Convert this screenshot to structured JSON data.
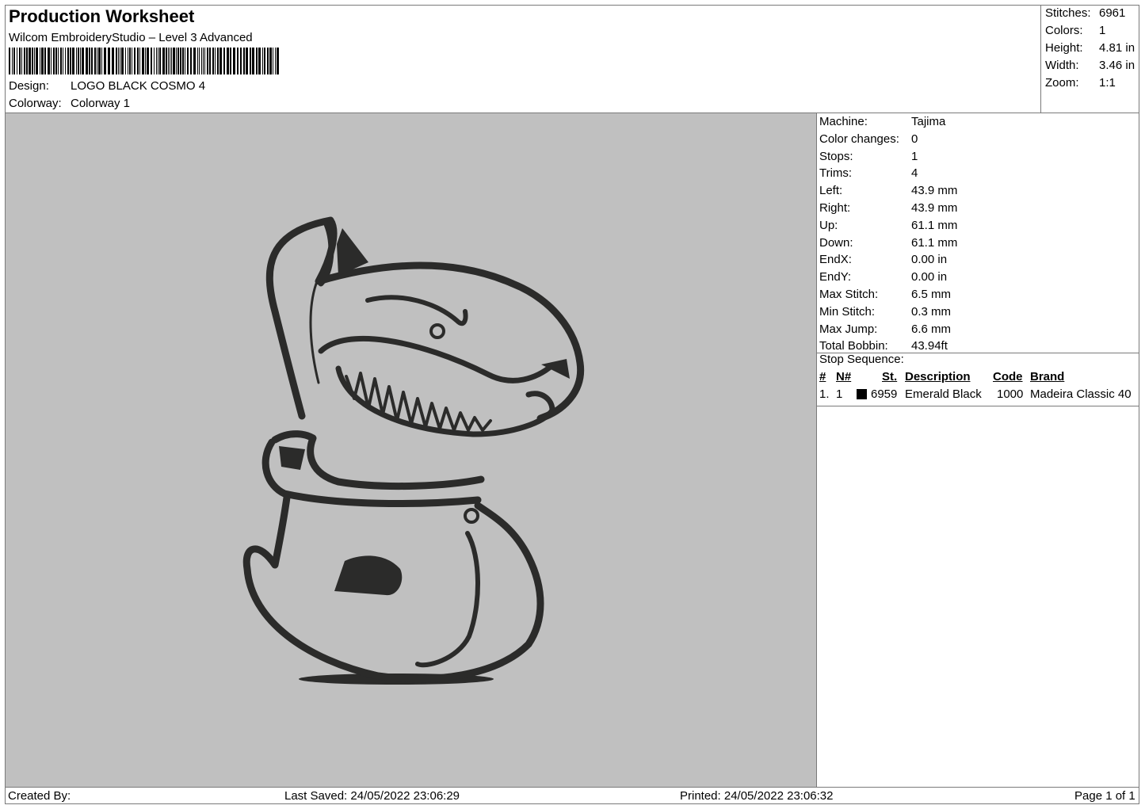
{
  "header": {
    "title": "Production Worksheet",
    "subtitle": "Wilcom EmbroideryStudio – Level 3 Advanced",
    "design_label": "Design:",
    "design_value": "LOGO BLACK COSMO 4",
    "colorway_label": "Colorway:",
    "colorway_value": "Colorway 1"
  },
  "summary": {
    "stitches_label": "Stitches:",
    "stitches_value": "6961",
    "colors_label": "Colors:",
    "colors_value": "1",
    "height_label": "Height:",
    "height_value": "4.81 in",
    "width_label": "Width:",
    "width_value": "3.46 in",
    "zoom_label": "Zoom:",
    "zoom_value": "1:1"
  },
  "details": [
    {
      "label": "Machine:",
      "value": "Tajima"
    },
    {
      "label": "Color changes:",
      "value": "0"
    },
    {
      "label": "Stops:",
      "value": "1"
    },
    {
      "label": "Trims:",
      "value": "4"
    },
    {
      "label": "Left:",
      "value": "43.9 mm"
    },
    {
      "label": "Right:",
      "value": "43.9 mm"
    },
    {
      "label": "Up:",
      "value": "61.1 mm"
    },
    {
      "label": "Down:",
      "value": "61.1 mm"
    },
    {
      "label": "EndX:",
      "value": "0.00 in"
    },
    {
      "label": "EndY:",
      "value": "0.00 in"
    },
    {
      "label": "Max Stitch:",
      "value": "6.5 mm"
    },
    {
      "label": "Min Stitch:",
      "value": "0.3 mm"
    },
    {
      "label": "Max Jump:",
      "value": "6.6 mm"
    },
    {
      "label": "Total Bobbin:",
      "value": "43.94ft"
    }
  ],
  "stop_sequence": {
    "title": "Stop Sequence:",
    "headers": {
      "num": "#",
      "n": "N#",
      "st": "St.",
      "description": "Description",
      "code": "Code",
      "brand": "Brand"
    },
    "rows": [
      {
        "num": "1.",
        "n": "1",
        "color": "#000000",
        "st": "6959",
        "description": "Emerald Black",
        "code": "1000",
        "brand": "Madeira Classic 40"
      }
    ]
  },
  "footer": {
    "created_by": "Created By:",
    "last_saved": "Last Saved: 24/05/2022 23:06:29",
    "printed": "Printed: 24/05/2022 23:06:32",
    "page": "Page 1 of 1"
  },
  "colors": {
    "canvas_bg": "#c0c0c0",
    "thread": "#2b2b2a",
    "border": "#7a7a7a"
  }
}
